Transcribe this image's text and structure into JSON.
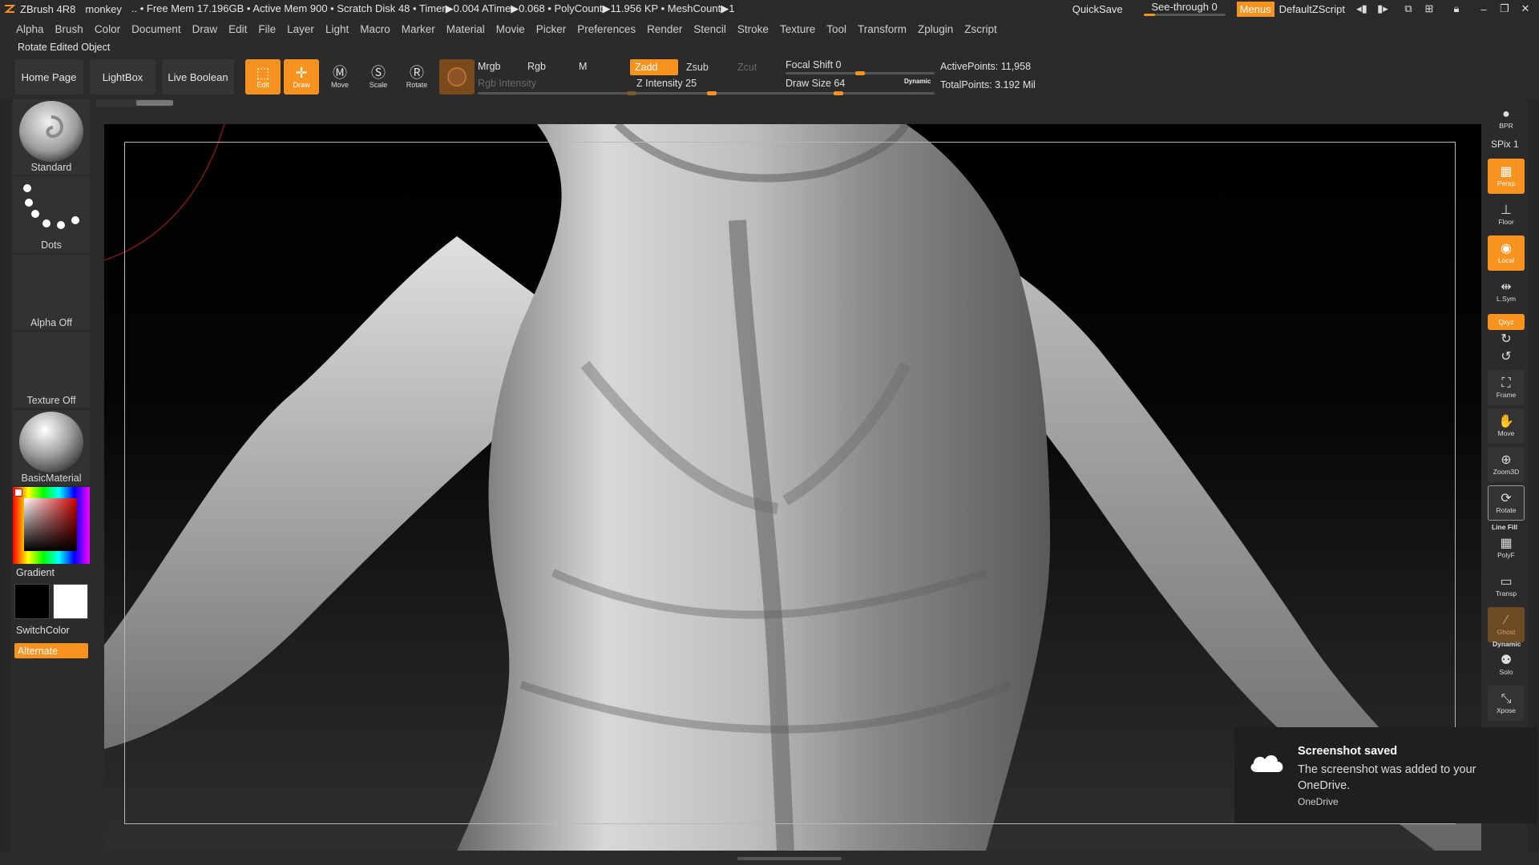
{
  "titlebar": {
    "app": "ZBrush 4R8",
    "doc": "monkey",
    "stats": ".. • Free Mem 17.196GB • Active Mem 900 • Scratch Disk 48 • Timer▶0.004 ATime▶0.068 • PolyCount▶11.956 KP • MeshCount▶1",
    "quicksave": "QuickSave",
    "seethrough": "See-through 0",
    "menus": "Menus",
    "script": "DefaultZScript"
  },
  "menubar": [
    "Alpha",
    "Brush",
    "Color",
    "Document",
    "Draw",
    "Edit",
    "File",
    "Layer",
    "Light",
    "Macro",
    "Marker",
    "Material",
    "Movie",
    "Picker",
    "Preferences",
    "Render",
    "Stencil",
    "Stroke",
    "Texture",
    "Tool",
    "Transform",
    "Zplugin",
    "Zscript"
  ],
  "status": "Rotate Edited Object",
  "toolbar": {
    "home": "Home Page",
    "lightbox": "LightBox",
    "liveboolean": "Live Boolean",
    "edit": "Edit",
    "draw": "Draw",
    "move": "Move",
    "scale": "Scale",
    "rotate": "Rotate",
    "mrgb": "Mrgb",
    "rgb": "Rgb",
    "m": "M",
    "rgb_intensity": "Rgb Intensity",
    "zadd": "Zadd",
    "zsub": "Zsub",
    "zcut": "Zcut",
    "z_intensity": "Z Intensity 25",
    "focal_shift": "Focal Shift 0",
    "draw_size": "Draw Size 64",
    "dynamic": "Dynamic",
    "active_points": "ActivePoints: 11,958",
    "total_points": "TotalPoints: 3.192 Mil",
    "z_intensity_value": 25,
    "focal_shift_value": 0,
    "draw_size_value": 64
  },
  "leftpanel": {
    "brush": "Standard",
    "stroke": "Dots",
    "alpha": "Alpha Off",
    "texture": "Texture Off",
    "material": "BasicMaterial",
    "gradient": "Gradient",
    "switchcolor": "SwitchColor",
    "alternate": "Alternate"
  },
  "rightpanel": {
    "bpr": "BPR",
    "spix": "SPix 1",
    "persp": "Persp",
    "floor": "Floor",
    "local": "Local",
    "lsym": "L.Sym",
    "xyz": "Qxyz",
    "frame": "Frame",
    "move": "Move",
    "zoom3d": "Zoom3D",
    "rotate": "Rotate",
    "linefill": "Line Fill",
    "polyf": "PolyF",
    "transp": "Transp",
    "ghost": "Ghost",
    "dynamic": "Dynamic",
    "solo": "Solo",
    "xpose": "Xpose"
  },
  "toast": {
    "title": "Screenshot saved",
    "message": "The screenshot was added to your OneDrive.",
    "source": "OneDrive"
  },
  "colors": {
    "accent": "#f7931e",
    "panel": "#323232",
    "background": "#2b2b2b"
  }
}
